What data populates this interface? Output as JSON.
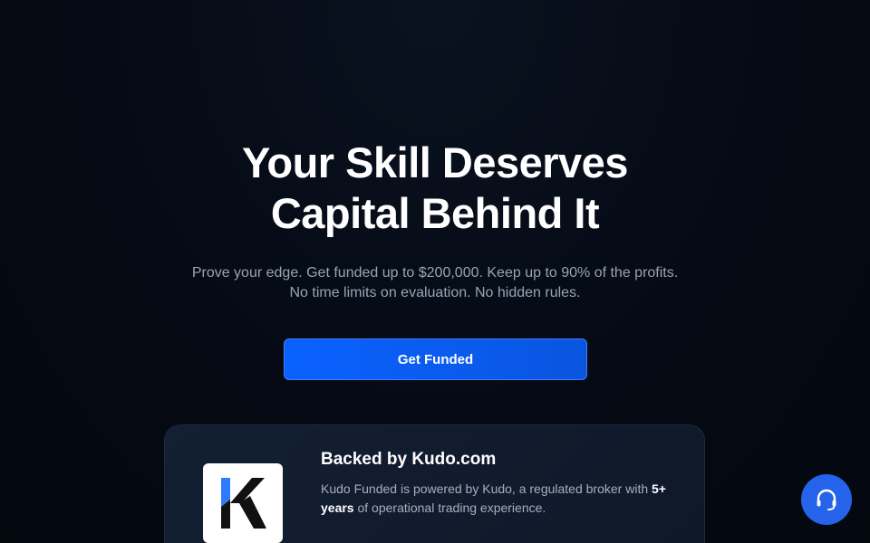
{
  "hero": {
    "title_line1": "Your Skill Deserves",
    "title_line2": "Capital Behind It",
    "subtitle": "Prove your edge. Get funded up to $200,000. Keep up to 90% of the profits. No time limits on evaluation. No hidden rules.",
    "cta_label": "Get Funded"
  },
  "backed_card": {
    "title": "Backed by Kudo.com",
    "text_before": "Kudo Funded is powered by Kudo, a regulated broker with ",
    "text_bold": "5+ years",
    "text_after": " of operational trading experience.",
    "logo_icon": "kudo-k-logo"
  },
  "support": {
    "icon": "headset-icon"
  },
  "colors": {
    "background": "#050a14",
    "accent": "#0a62ff",
    "card": "#131f33",
    "support": "#2563eb",
    "logo_blue": "#2f7bff",
    "logo_black": "#111111"
  }
}
